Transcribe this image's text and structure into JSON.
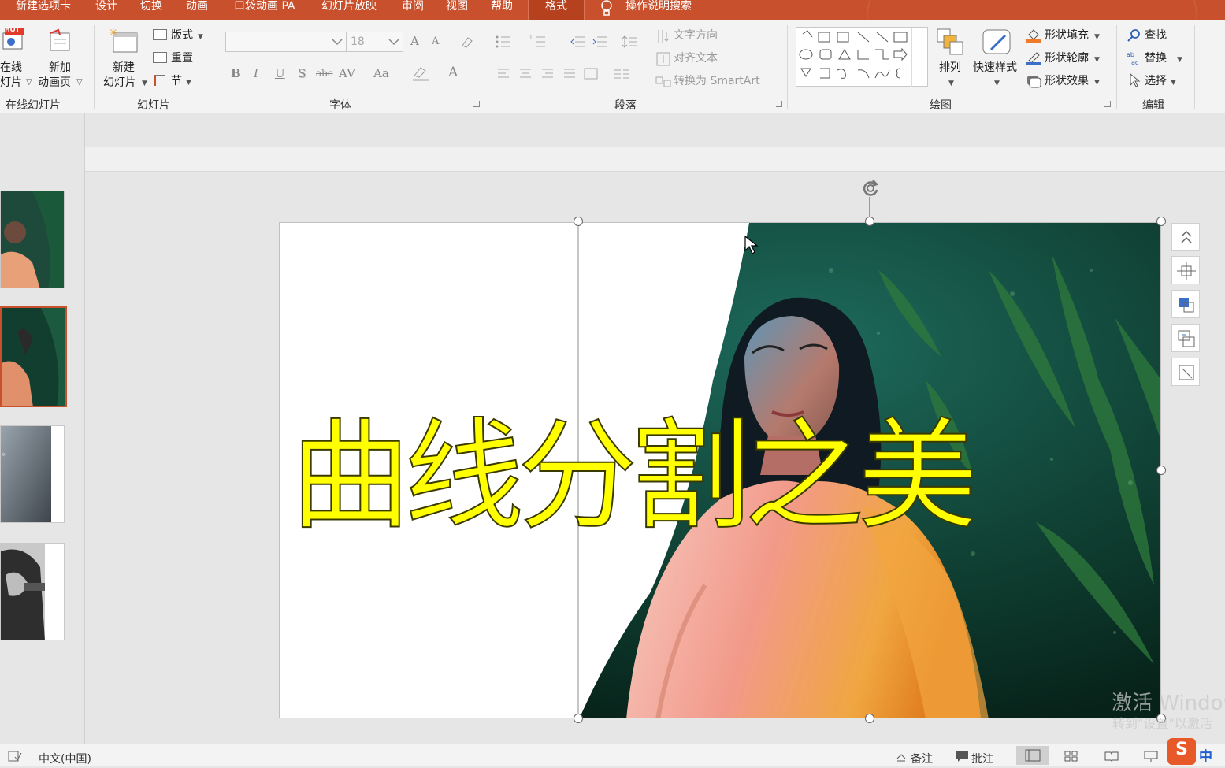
{
  "tabs": [
    {
      "label": "新建选项卡"
    },
    {
      "label": "设计"
    },
    {
      "label": "切换"
    },
    {
      "label": "动画"
    },
    {
      "label": "口袋动画 PA"
    },
    {
      "label": "幻灯片放映"
    },
    {
      "label": "审阅"
    },
    {
      "label": "视图"
    },
    {
      "label": "帮助"
    },
    {
      "label": "格式"
    }
  ],
  "search_hint": "操作说明搜索",
  "ribbon": {
    "online_slides": {
      "btn_line1": "在线",
      "btn_line2": "灯片",
      "hot_badge": "HOT",
      "new_anim_line1": "新加",
      "new_anim_line2": "动画页",
      "group": "在线幻灯片"
    },
    "slides": {
      "new_line1": "新建",
      "new_line2": "幻灯片",
      "layout": "版式",
      "reset": "重置",
      "section": "节",
      "group": "幻灯片"
    },
    "font": {
      "size": "18",
      "group": "字体",
      "bold": "B",
      "italic": "I",
      "underline": "U",
      "shadow": "S",
      "strike": "abc",
      "spacing": "AV",
      "case": "Aa",
      "grow": "A",
      "shrink": "A"
    },
    "paragraph": {
      "text_direction": "文字方向",
      "align_text": "对齐文本",
      "smartart": "转换为 SmartArt",
      "group": "段落"
    },
    "drawing": {
      "arrange": "排列",
      "quick_styles": "快速样式",
      "fill": "形状填充",
      "outline": "形状轮廓",
      "effects": "形状效果",
      "group": "绘图"
    },
    "editing": {
      "find": "查找",
      "replace": "替换",
      "select": "选择",
      "group": "编辑"
    }
  },
  "slide": {
    "title": "曲线分割之美"
  },
  "watermark": {
    "line1": "激活 Windows",
    "line2": "转到\"设置\"以激活"
  },
  "status": {
    "language": "中文(中国)",
    "notes": "备注",
    "comments": "批注",
    "ime": "中"
  },
  "colors": {
    "accent": "#c8502c",
    "title_fill": "#ffff00"
  }
}
